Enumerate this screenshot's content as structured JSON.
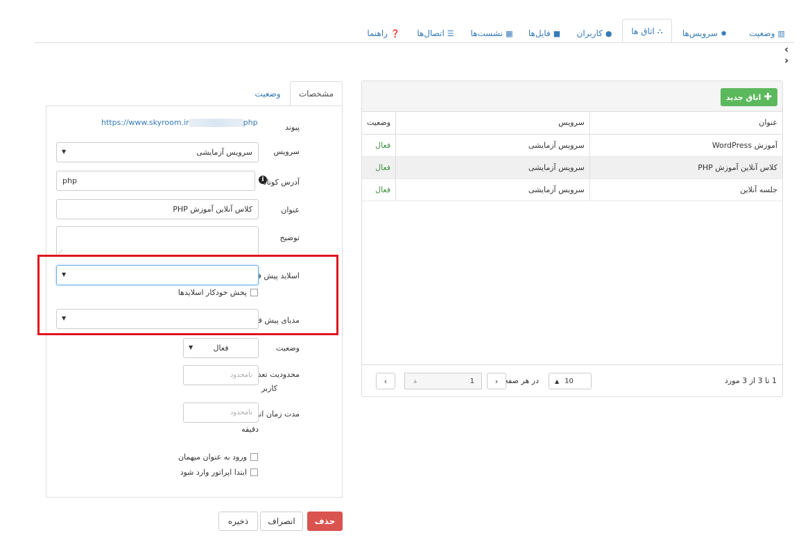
{
  "nav": {
    "tabs": [
      {
        "label": "وضعیت",
        "icon": "bar-chart-icon"
      },
      {
        "label": "سرویس‌ها",
        "icon": "gear-icon"
      },
      {
        "label": "اتاق ها",
        "icon": "sitemap-icon"
      },
      {
        "label": "کاربران",
        "icon": "user-icon"
      },
      {
        "label": "فایل‌ها",
        "icon": "file-icon"
      },
      {
        "label": "نشست‌ها",
        "icon": "grid-icon"
      },
      {
        "label": "اتصال‌ها",
        "icon": "list-icon"
      },
      {
        "label": "راهنما",
        "icon": "question-icon"
      }
    ],
    "active_tab": "اتاق ها"
  },
  "rooms": {
    "new_button": "اتاق جدید",
    "columns": {
      "title": "عنوان",
      "service": "سرویس",
      "status": "وضعیت"
    },
    "rows": [
      {
        "title": "آموزش WordPress",
        "service": "سرویس آزمایشی",
        "status": "فعال"
      },
      {
        "title": "کلاس آنلاین آموزش PHP",
        "service": "سرویس آزمایشی",
        "status": "فعال"
      },
      {
        "title": "جلسه آنلاین",
        "service": "سرویس آزمایشی",
        "status": "فعال"
      }
    ],
    "pager": {
      "summary": "1 تا 3 از 3 مورد",
      "page_size": "10",
      "per_page_label": "در هر صفحه",
      "current_page": "1"
    }
  },
  "form": {
    "tabs": {
      "details": "مشخصات",
      "status": "وضعیت"
    },
    "link_label": "پیوند",
    "link_prefix": "https://www.skyroom.ir",
    "link_suffix": "php",
    "service_label": "سرویس",
    "service_value": "سرویس آزمایشی",
    "short_address_label": "آدرس کوتاه",
    "short_address_value": "php",
    "title_label": "عنوان",
    "title_value": "کلاس آنلاین آموزش PHP",
    "description_label": "توضیح",
    "default_slide_label": "اسلاید پیش فرض",
    "autoplay_slides_label": "پخش خودکار اسلایدها",
    "default_media_label": "مدیای پیش فرض",
    "status_label": "وضعیت",
    "status_value": "فعال",
    "user_limit_label_1": "محدودیت تعداد",
    "user_limit_label_2": "کاربر",
    "user_limit_placeholder": "نامحدود",
    "time_limit_label": "مدت زمان اتصال",
    "time_limit_placeholder": "نامحدود",
    "minute_label": "دقیقه",
    "guest_login_label": "ورود به عنوان میهمان",
    "operator_first_label": "ابتدا اپراتور وارد شود"
  },
  "actions": {
    "delete": "حذف",
    "cancel": "انصراف",
    "save": "ذخیره"
  },
  "colors": {
    "primary": "#337ab7",
    "success": "#5cb85c",
    "danger": "#d9534f",
    "highlight": "#e0141e"
  }
}
